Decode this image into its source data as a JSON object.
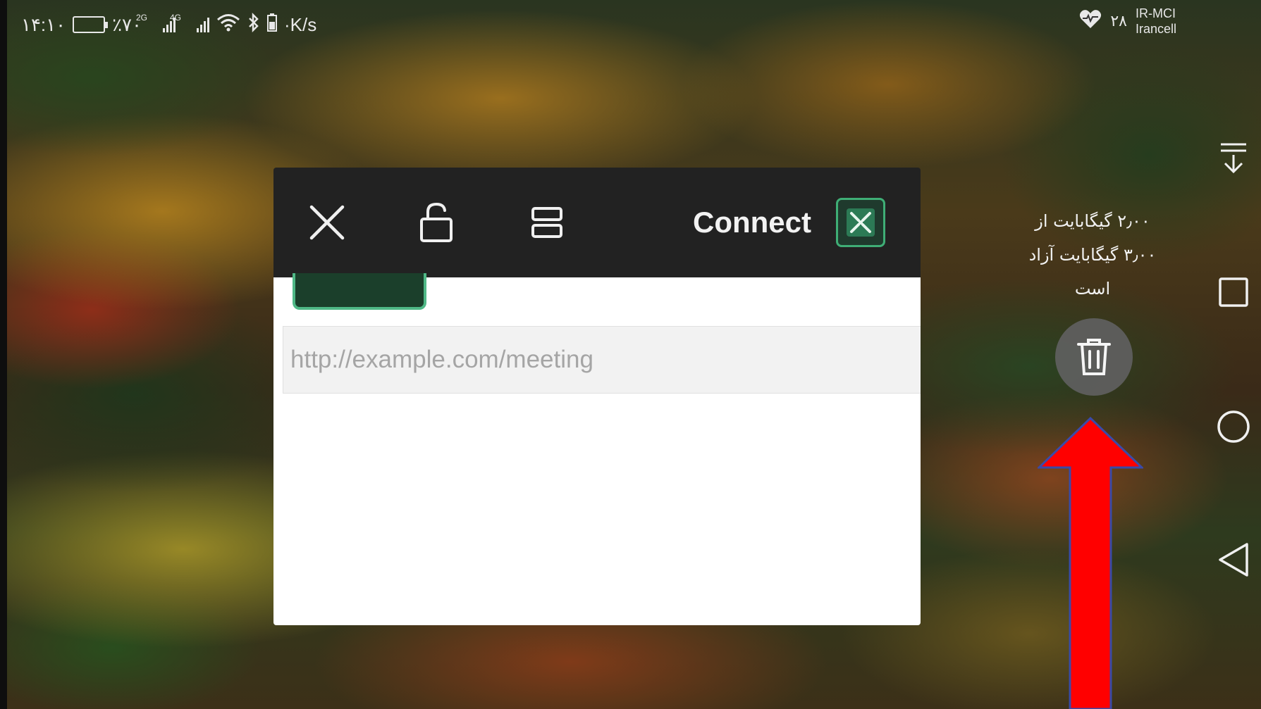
{
  "status_bar": {
    "time": "۱۴:۱۰",
    "battery_percent": "٪۷۰",
    "battery_level": 0.7,
    "sim1_tag": "2G",
    "sim2_tag": "4G",
    "net_speed": "·K/s",
    "carrier_line1": "IR-MCI",
    "carrier_line2": "Irancell",
    "heart_value": "۲۸"
  },
  "popup": {
    "connect_label": "Connect",
    "url_placeholder": "http://example.com/meeting",
    "icons": [
      "close-icon",
      "unlock-icon",
      "layout-icon",
      "connect-app-icon"
    ]
  },
  "storage": {
    "line1": "۲٫۰۰ گیگابایت از",
    "line2": "۳٫۰۰ گیگابایت آزاد",
    "line3": "است"
  },
  "nav": {
    "icons": [
      "collapse-icon",
      "recent-apps-icon",
      "home-icon",
      "back-icon"
    ]
  },
  "colors": {
    "popup_bar": "#222222",
    "accent_green": "#3fae76",
    "arrow_red": "#ff0000"
  }
}
